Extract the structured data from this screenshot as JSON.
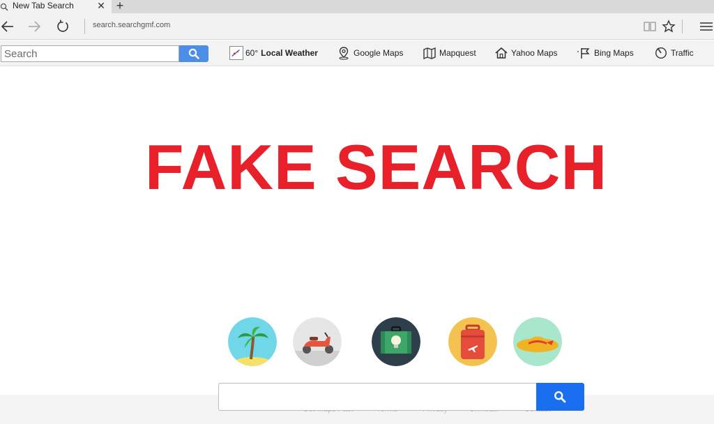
{
  "tab": {
    "title": "New Tab Search",
    "close": "✕",
    "new_tab": "+"
  },
  "address": {
    "url": "search.searchgmf.com"
  },
  "toolbar": {
    "search_placeholder": "Search",
    "weather_temp": "60°",
    "weather_label": "Local Weather",
    "links": [
      "Google Maps",
      "Mapquest",
      "Yahoo Maps",
      "Bing Maps",
      "Traffic"
    ]
  },
  "headline": "FAKE SEARCH",
  "feature_icons": [
    "palm-tree-icon",
    "scooter-icon",
    "suitcase-lightbulb-icon",
    "luggage-icon",
    "sun-hat-icon"
  ],
  "footer_links": [
    "Get Maps Fast",
    "Terms",
    "Privacy",
    "Uninstall",
    "Contact"
  ],
  "main_search": {
    "placeholder": ""
  },
  "colors": {
    "headline": "#e8202a",
    "toolbar_search_button": "#4a8ee8",
    "main_search_button": "#1a6ff0"
  }
}
